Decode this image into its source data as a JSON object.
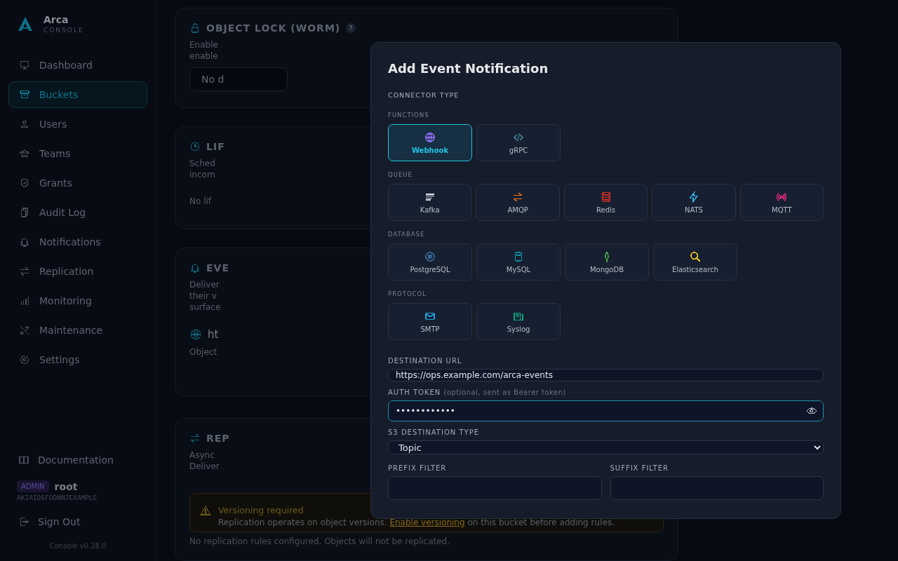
{
  "sidebar": {
    "brand": {
      "name": "Arca",
      "subtitle": "CONSOLE"
    },
    "nav": [
      {
        "label": "Dashboard",
        "selected": false
      },
      {
        "label": "Buckets",
        "selected": true
      },
      {
        "label": "Users",
        "selected": false
      },
      {
        "label": "Teams",
        "selected": false
      },
      {
        "label": "Grants",
        "selected": false
      },
      {
        "label": "Audit Log",
        "selected": false
      },
      {
        "label": "Notifications",
        "selected": false
      },
      {
        "label": "Replication",
        "selected": false
      },
      {
        "label": "Monitoring",
        "selected": false
      },
      {
        "label": "Maintenance",
        "selected": false
      },
      {
        "label": "Settings",
        "selected": false
      }
    ],
    "docs": "Documentation",
    "role": "ADMIN",
    "user": "root",
    "access_key": "AKIAIOSFODNN7EXAMPLE",
    "sign_out": "Sign Out",
    "version": "Console v0.28.0"
  },
  "background": {
    "cards": [
      {
        "title": "OBJECT LOCK (WORM)",
        "help": "?",
        "lines": [
          "Enable",
          "enable"
        ],
        "control": "No d"
      },
      {
        "title": "LIF",
        "lines": [
          "Sched",
          "incom"
        ],
        "note": "No lif"
      },
      {
        "title": "EVE",
        "lines": [
          "Deliver",
          "their v",
          "surface"
        ],
        "target": "ht",
        "target_sub": "Object"
      },
      {
        "title": "REP",
        "lines": [
          "Async",
          "Deliver"
        ]
      }
    ],
    "warning": {
      "title": "Versioning required",
      "text": "Replication operates on object versions. ",
      "link": "Enable versioning",
      "after": " on this bucket before adding rules."
    },
    "empty_note": "No replication rules configured. Objects will not be replicated."
  },
  "modal": {
    "title": "Add Event Notification",
    "section": "CONNECTOR TYPE",
    "groups": [
      {
        "label": "FUNCTIONS",
        "items": [
          {
            "label": "Webhook",
            "color": "#8b6cf0",
            "selected": true
          },
          {
            "label": "gRPC",
            "color": "#3b6f80",
            "selected": false
          }
        ]
      },
      {
        "label": "QUEUE",
        "items": [
          {
            "label": "Kafka",
            "color": "#e5e7eb",
            "selected": false
          },
          {
            "label": "AMQP",
            "color": "#f97316",
            "selected": false
          },
          {
            "label": "Redis",
            "color": "#dc2f26",
            "selected": false
          },
          {
            "label": "NATS",
            "color": "#38a8e0",
            "selected": false
          },
          {
            "label": "MQTT",
            "color": "#db2777",
            "selected": false
          }
        ]
      },
      {
        "label": "DATABASE",
        "items": [
          {
            "label": "PostgreSQL",
            "color": "#336791",
            "selected": false
          },
          {
            "label": "MySQL",
            "color": "#0e93a8",
            "selected": false
          },
          {
            "label": "MongoDB",
            "color": "#47a248",
            "selected": false
          },
          {
            "label": "Elasticsearch",
            "color": "#f5c518",
            "selected": false
          }
        ]
      },
      {
        "label": "PROTOCOL",
        "items": [
          {
            "label": "SMTP",
            "color": "#1ea7e6",
            "selected": false
          },
          {
            "label": "Syslog",
            "color": "#10a37f",
            "selected": false
          }
        ]
      }
    ],
    "url": {
      "label": "DESTINATION URL",
      "value": "https://ops.example.com/arca-events"
    },
    "token": {
      "label": "AUTH TOKEN",
      "hint": "(optional, sent as Bearer token)",
      "value": "••••••••••••",
      "focused": true
    },
    "dest_type": {
      "label": "S3 DESTINATION TYPE",
      "value": "Topic"
    },
    "filters": [
      {
        "label": "PREFIX FILTER"
      },
      {
        "label": "SUFFIX FILTER"
      }
    ]
  }
}
